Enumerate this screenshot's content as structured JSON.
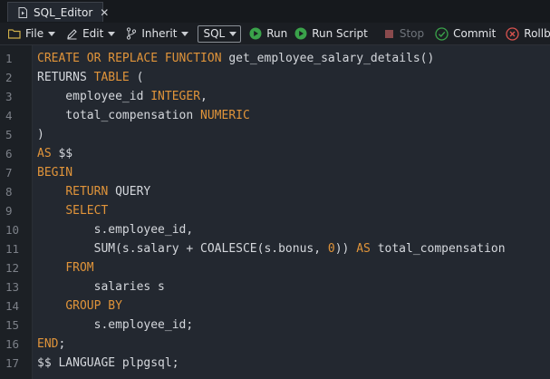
{
  "tab": {
    "title": "SQL_Editor",
    "close": "✕"
  },
  "toolbar": {
    "file": "File",
    "edit": "Edit",
    "inherit": "Inherit",
    "language": "SQL",
    "run": "Run",
    "run_script": "Run Script",
    "stop": "Stop",
    "commit": "Commit",
    "rollback": "Rollback"
  },
  "colors": {
    "keyword": "#e0943a",
    "run_green": "#3aa24a",
    "rollback_red": "#d9534f"
  },
  "editor": {
    "lines": [
      {
        "n": "1",
        "tokens": [
          {
            "t": "CREATE",
            "k": 1
          },
          {
            "t": " "
          },
          {
            "t": "OR",
            "k": 1
          },
          {
            "t": " "
          },
          {
            "t": "REPLACE",
            "k": 1
          },
          {
            "t": " "
          },
          {
            "t": "FUNCTION",
            "k": 1
          },
          {
            "t": " get_employee_salary_details()"
          }
        ]
      },
      {
        "n": "2",
        "tokens": [
          {
            "t": "RETURNS "
          },
          {
            "t": "TABLE",
            "k": 1
          },
          {
            "t": " ("
          }
        ]
      },
      {
        "n": "3",
        "tokens": [
          {
            "t": "    employee_id "
          },
          {
            "t": "INTEGER",
            "k": 1
          },
          {
            "t": ","
          }
        ]
      },
      {
        "n": "4",
        "tokens": [
          {
            "t": "    total_compensation "
          },
          {
            "t": "NUMERIC",
            "k": 1
          }
        ]
      },
      {
        "n": "5",
        "tokens": [
          {
            "t": ")"
          }
        ]
      },
      {
        "n": "6",
        "tokens": [
          {
            "t": "AS",
            "k": 1
          },
          {
            "t": " $$"
          }
        ]
      },
      {
        "n": "7",
        "tokens": [
          {
            "t": "BEGIN",
            "k": 1
          }
        ]
      },
      {
        "n": "8",
        "tokens": [
          {
            "t": "    "
          },
          {
            "t": "RETURN",
            "k": 1
          },
          {
            "t": " QUERY"
          }
        ]
      },
      {
        "n": "9",
        "tokens": [
          {
            "t": "    "
          },
          {
            "t": "SELECT",
            "k": 1
          }
        ]
      },
      {
        "n": "10",
        "tokens": [
          {
            "t": "        s.employee_id,"
          }
        ]
      },
      {
        "n": "11",
        "tokens": [
          {
            "t": "        SUM(s.salary + COALESCE(s.bonus, "
          },
          {
            "t": "0",
            "k": 1
          },
          {
            "t": ")) "
          },
          {
            "t": "AS",
            "k": 1
          },
          {
            "t": " total_compensation"
          }
        ]
      },
      {
        "n": "12",
        "tokens": [
          {
            "t": "    "
          },
          {
            "t": "FROM",
            "k": 1
          }
        ]
      },
      {
        "n": "13",
        "tokens": [
          {
            "t": "        salaries s"
          }
        ]
      },
      {
        "n": "14",
        "tokens": [
          {
            "t": "    "
          },
          {
            "t": "GROUP BY",
            "k": 1
          }
        ]
      },
      {
        "n": "15",
        "tokens": [
          {
            "t": "        s.employee_id;"
          }
        ]
      },
      {
        "n": "16",
        "tokens": [
          {
            "t": "END",
            "k": 1
          },
          {
            "t": ";"
          }
        ]
      },
      {
        "n": "17",
        "tokens": [
          {
            "t": "$$ LANGUAGE plpgsql;"
          }
        ]
      }
    ]
  }
}
